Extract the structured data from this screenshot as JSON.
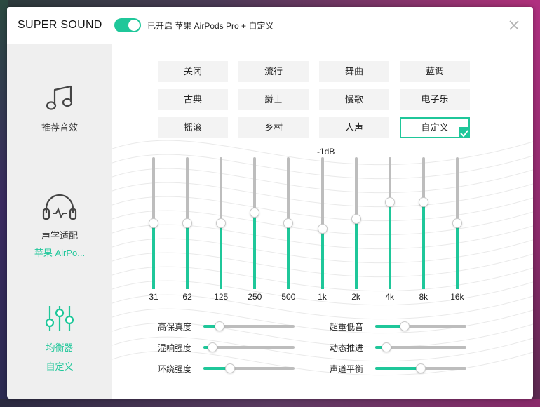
{
  "header": {
    "title": "SUPER SOUND",
    "status": "已开启 苹果 AirPods Pro + 自定义",
    "toggle_on": true
  },
  "sidebar": {
    "items": [
      {
        "label": "推荐音效",
        "icon": "music-note-icon"
      },
      {
        "label": "声学适配",
        "sub": "苹果 AirPo...",
        "icon": "headphones-icon"
      },
      {
        "label": "均衡器",
        "sub": "自定义",
        "icon": "equalizer-icon",
        "active": true
      }
    ]
  },
  "presets": [
    "关闭",
    "流行",
    "舞曲",
    "蓝调",
    "古典",
    "爵士",
    "慢歌",
    "电子乐",
    "摇滚",
    "乡村",
    "人声",
    "自定义"
  ],
  "selected_preset": "自定义",
  "equalizer": {
    "db_label": "-1dB",
    "bands": [
      {
        "freq": "31",
        "level": 0.5
      },
      {
        "freq": "62",
        "level": 0.5
      },
      {
        "freq": "125",
        "level": 0.5
      },
      {
        "freq": "250",
        "level": 0.58
      },
      {
        "freq": "500",
        "level": 0.5
      },
      {
        "freq": "1k",
        "level": 0.46
      },
      {
        "freq": "2k",
        "level": 0.53
      },
      {
        "freq": "4k",
        "level": 0.66
      },
      {
        "freq": "8k",
        "level": 0.66
      },
      {
        "freq": "16k",
        "level": 0.5
      }
    ]
  },
  "effects": {
    "left": [
      {
        "label": "高保真度",
        "value": 0.14
      },
      {
        "label": "混响强度",
        "value": 0.05
      },
      {
        "label": "环绕强度",
        "value": 0.27
      }
    ],
    "right": [
      {
        "label": "超重低音",
        "value": 0.3
      },
      {
        "label": "动态推进",
        "value": 0.08
      },
      {
        "label": "声道平衡",
        "value": 0.5
      }
    ]
  },
  "colors": {
    "accent": "#1fc79a",
    "rail": "#bdbdbd",
    "sidebar_bg": "#efefef"
  }
}
